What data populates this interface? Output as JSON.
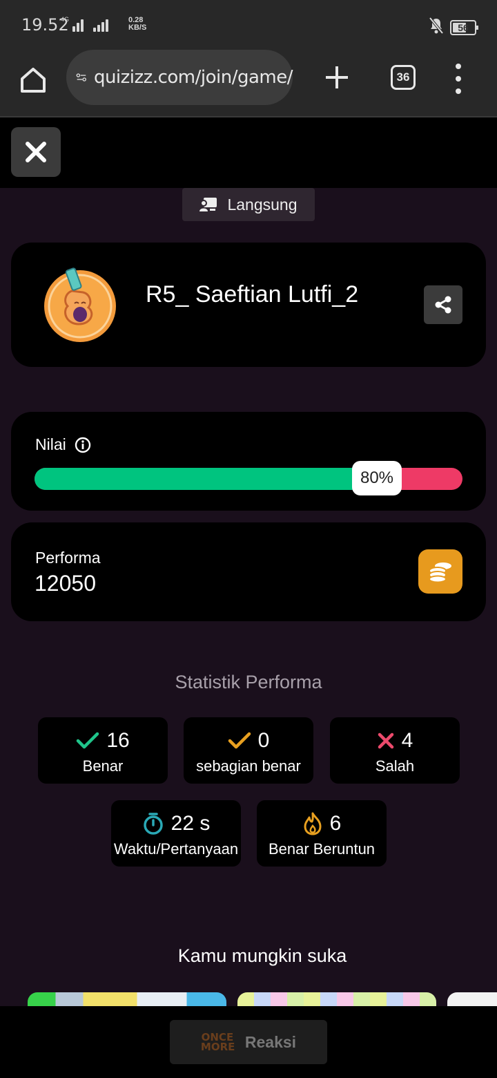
{
  "status_bar": {
    "time": "19.52",
    "network": "4G",
    "speed_value": "0.28",
    "speed_unit": "KB/S",
    "battery": "56"
  },
  "browser": {
    "url": "quizizz.com/join/game/",
    "tab_count": "36"
  },
  "mode_chip": {
    "label": "Langsung"
  },
  "player": {
    "name": "R5_ Saeftian Lutfi_2"
  },
  "score": {
    "label": "Nilai",
    "percent_text": "80%",
    "percent_value": 80
  },
  "performance": {
    "label": "Performa",
    "value": "12050"
  },
  "stats": {
    "title": "Statistik Performa",
    "correct": {
      "value": "16",
      "label": "Benar"
    },
    "partial": {
      "value": "0",
      "label": "sebagian benar"
    },
    "wrong": {
      "value": "4",
      "label": "Salah"
    },
    "time": {
      "value": "22 s",
      "label": "Waktu/Pertanyaan"
    },
    "streak": {
      "value": "6",
      "label": "Benar Beruntun"
    }
  },
  "suggestions": {
    "title": "Kamu mungkin suka"
  },
  "bottom": {
    "reaction_logo": "ONCE MORE",
    "reaction_label": "Reaksi"
  },
  "colors": {
    "progress_correct": "#00c47f",
    "progress_wrong": "#ee3a66",
    "coin": "#e79a1e",
    "check_green": "#1fc48a",
    "check_orange": "#e8a020",
    "cross_red": "#ec4a6c",
    "timer_teal": "#2aa9b6"
  }
}
